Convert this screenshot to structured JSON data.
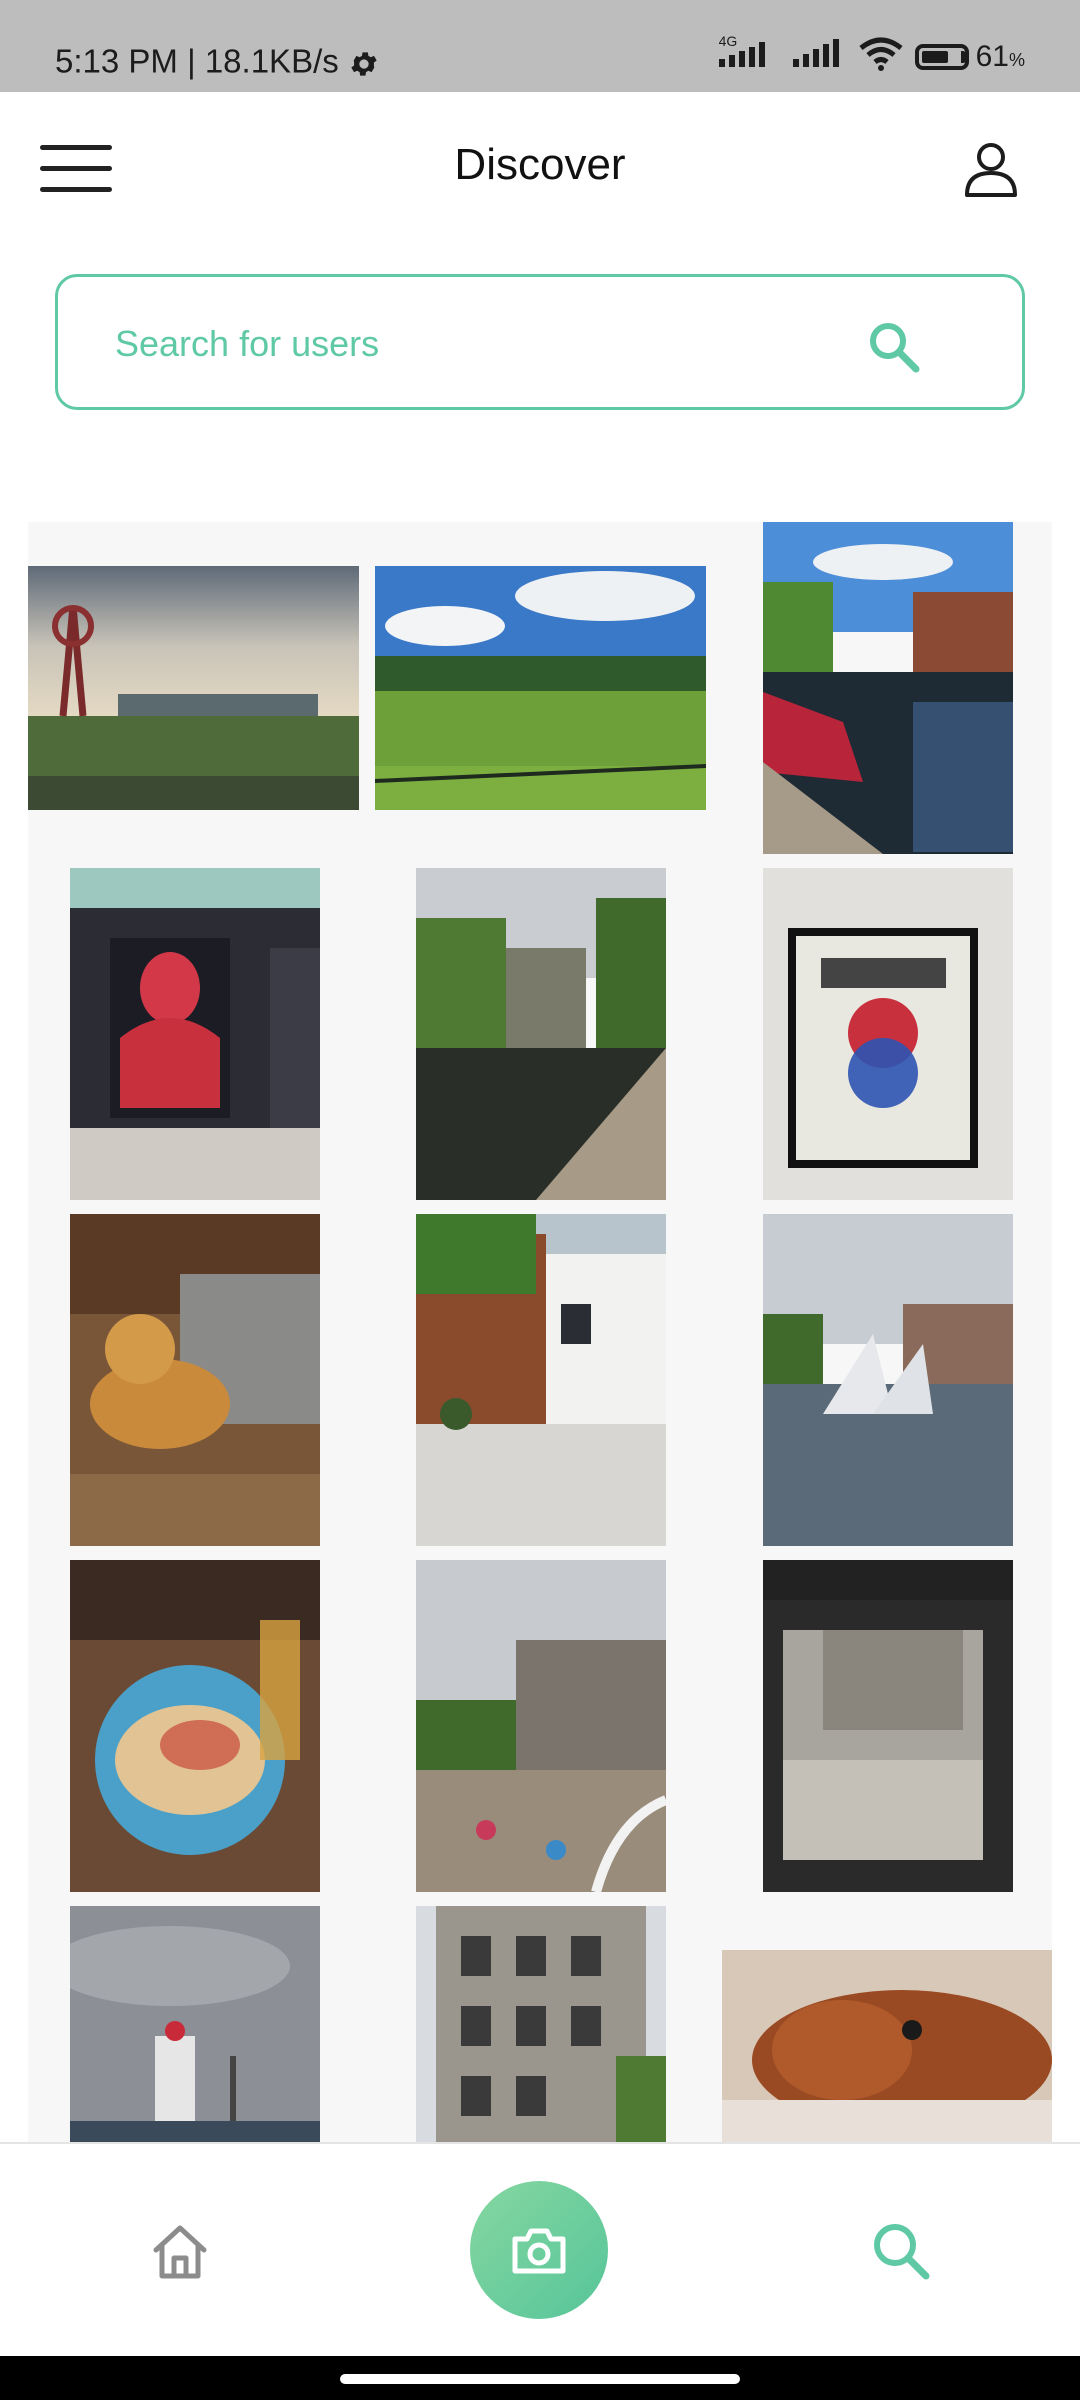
{
  "status_bar": {
    "time": "5:13 PM",
    "speed": "18.1KB/s",
    "network_label": "4G",
    "battery_percent": "61",
    "battery_unit": "%"
  },
  "header": {
    "title": "Discover"
  },
  "search": {
    "placeholder": "Search for users"
  },
  "photos": [
    {
      "subject": "orbit tower and stadium under cloudy sky"
    },
    {
      "subject": "green park field with trees"
    },
    {
      "subject": "canal boat with trees and reflections"
    },
    {
      "subject": "red mural street art"
    },
    {
      "subject": "canal path with trees"
    },
    {
      "subject": "framed poster with red and blue circles"
    },
    {
      "subject": "golden retriever on wooden floor"
    },
    {
      "subject": "garden with white gravel and modern house"
    },
    {
      "subject": "sculpture in water by buildings"
    },
    {
      "subject": "plate of food on table"
    },
    {
      "subject": "brutalist concrete building with market"
    },
    {
      "subject": "concrete building through doorway"
    },
    {
      "subject": "monument under cloudy sky"
    },
    {
      "subject": "concrete building facade"
    },
    {
      "subject": "sleeping dog"
    }
  ],
  "colors": {
    "accent": "#5ec9a4",
    "camera_gradient_start": "#86d7a0",
    "camera_gradient_end": "#56c59a"
  },
  "icons": {
    "menu": "hamburger-icon",
    "profile": "person-icon",
    "search": "search-icon",
    "home": "home-icon",
    "camera": "camera-icon",
    "settings": "gear-icon"
  }
}
